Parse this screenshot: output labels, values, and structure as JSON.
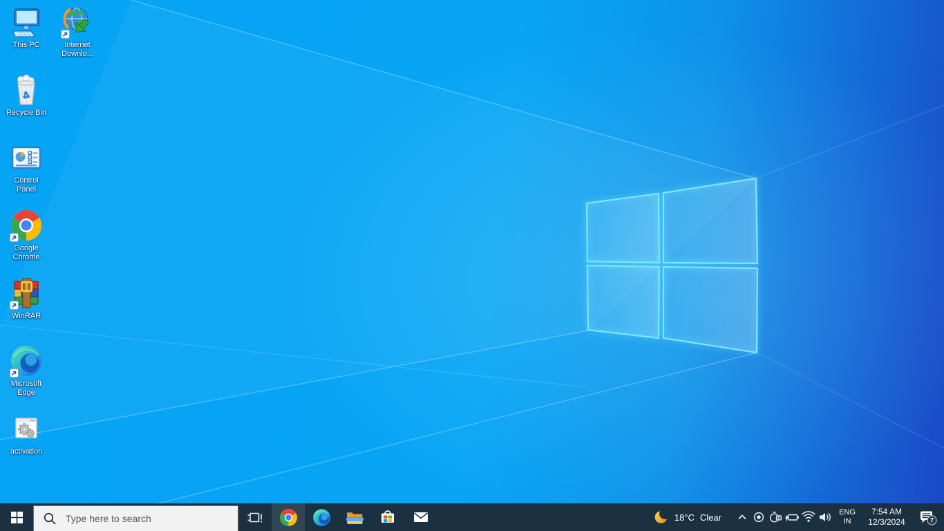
{
  "wallpaper": {
    "base_color": "#07a3f4",
    "deep_color": "#1a49c8",
    "logo_stroke_color": "#79e9fc"
  },
  "desktop": {
    "icons": [
      {
        "id": "this-pc",
        "icon": "this-pc-icon",
        "label1": "This PC",
        "label2": ""
      },
      {
        "id": "idm",
        "icon": "internet-download-manager-icon",
        "label1": "Internet",
        "label2": "Downlo..."
      },
      {
        "id": "recycle-bin",
        "icon": "recycle-bin-icon",
        "label1": "Recycle Bin",
        "label2": ""
      },
      {
        "id": "control-panel",
        "icon": "control-panel-icon",
        "label1": "Control",
        "label2": "Panel"
      },
      {
        "id": "google-chrome",
        "icon": "chrome-icon",
        "label1": "Google",
        "label2": "Chrome"
      },
      {
        "id": "winrar",
        "icon": "winrar-icon",
        "label1": "WinRAR",
        "label2": ""
      },
      {
        "id": "microsoft-edge",
        "icon": "edge-icon",
        "label1": "Microsoft",
        "label2": "Edge"
      },
      {
        "id": "activation",
        "icon": "activation-icon",
        "label1": "activation",
        "label2": ""
      }
    ]
  },
  "taskbar": {
    "colors": {
      "taskbar_bg": "#1b3040",
      "search_bg": "#f2f2f2"
    },
    "search": {
      "placeholder": "Type here to search"
    },
    "pinned_icons": [
      "task-view-icon",
      "chrome-icon",
      "edge-icon",
      "file-explorer-icon",
      "microsoft-store-icon",
      "mail-icon"
    ],
    "weather": {
      "icon": "moon-icon",
      "temperature": "18°C",
      "condition": "Clear"
    },
    "tray_icons": [
      "chevron-up-icon",
      "record-dot-icon",
      "meet-now-icon",
      "battery-charging-icon",
      "wifi-icon",
      "volume-icon"
    ],
    "language": {
      "line1": "ENG",
      "line2": "IN"
    },
    "clock": {
      "time": "7:54 AM",
      "date": "12/3/2024"
    },
    "notifications": {
      "count": "7"
    }
  }
}
